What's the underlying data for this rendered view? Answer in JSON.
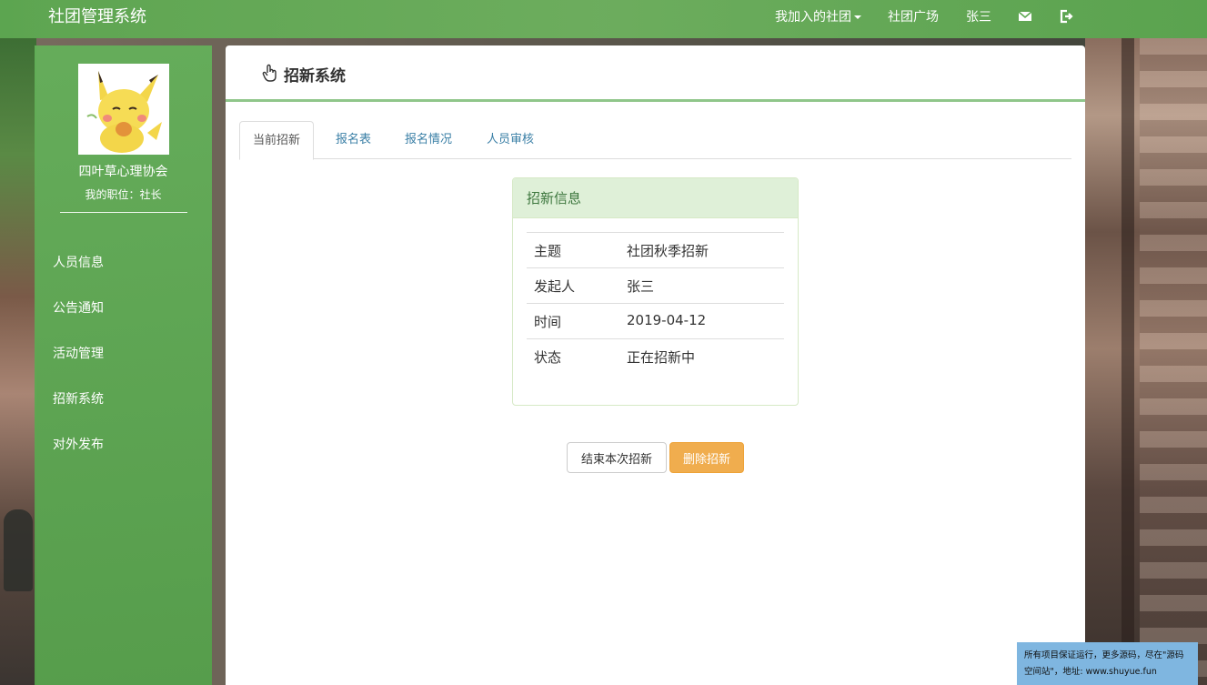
{
  "navbar": {
    "brand": "社团管理系统",
    "my_clubs": "我加入的社团",
    "club_square": "社团广场",
    "user": "张三"
  },
  "sidebar": {
    "club_name": "四叶草心理协会",
    "role": "我的职位：社长",
    "items": [
      {
        "label": "人员信息"
      },
      {
        "label": "公告通知"
      },
      {
        "label": "活动管理"
      },
      {
        "label": "招新系统"
      },
      {
        "label": "对外发布"
      }
    ]
  },
  "main": {
    "title": "招新系统",
    "tabs": [
      {
        "label": "当前招新",
        "active": true
      },
      {
        "label": "报名表"
      },
      {
        "label": "报名情况"
      },
      {
        "label": "人员审核"
      }
    ],
    "card": {
      "heading": "招新信息",
      "rows": [
        {
          "key": "主题",
          "value": "社团秋季招新"
        },
        {
          "key": "发起人",
          "value": "张三"
        },
        {
          "key": "时间",
          "value": "2019-04-12"
        },
        {
          "key": "状态",
          "value": "正在招新中"
        }
      ]
    },
    "buttons": {
      "end": "结束本次招新",
      "delete": "删除招新"
    }
  },
  "watermark": {
    "line1": "所有项目保证运行，更多源码，尽在\"源码",
    "line2": "空间站\"，地址: www.shuyue.fun"
  },
  "colors": {
    "nav_green": "#5ca850",
    "sidebar_green": "#64b25a",
    "panel_rule": "#8fc68a",
    "tab_link": "#3a7fa6",
    "card_header_bg": "#dff0d8",
    "card_header_text": "#3c763d",
    "warning_button": "#f0ad4e"
  },
  "icons": [
    "caret-down-icon",
    "envelope-icon",
    "logout-icon",
    "hand-pointer-icon"
  ]
}
